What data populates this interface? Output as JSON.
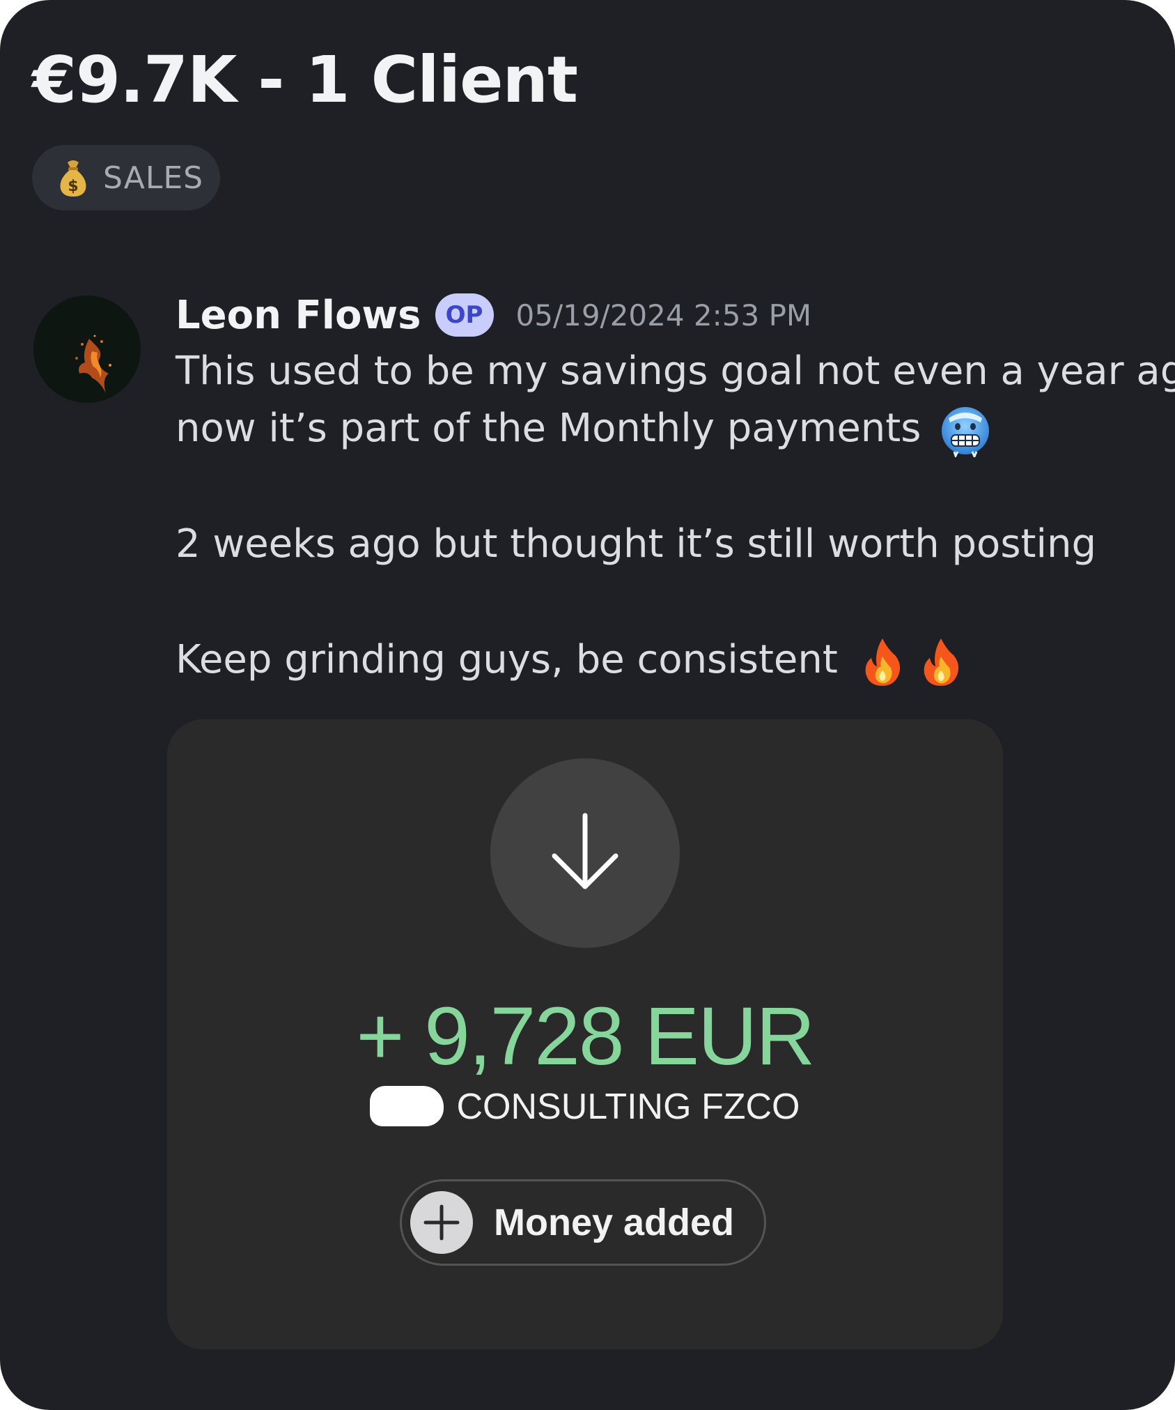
{
  "post": {
    "title": "€9.7K - 1 Client",
    "tag": {
      "icon": "money-bag-icon",
      "label": "SALES"
    }
  },
  "message": {
    "author": "Leon Flows",
    "badge": "OP",
    "timestamp": "05/19/2024 2:53 PM",
    "avatar_icon": "fire-figure-avatar",
    "lines": {
      "l1": "This used to be my savings goal not even a year ago,",
      "l2": "now it’s part of the Monthly payments",
      "l3": "2 weeks ago but thought it’s still worth posting",
      "l4": "Keep grinding guys, be consistent"
    },
    "emojis": [
      "cold-face-emoji",
      "fire-emoji",
      "fire-emoji"
    ]
  },
  "attachment": {
    "icon": "arrow-down-icon",
    "amount": "+ 9,728 EUR",
    "payer": "CONSULTING FZCO",
    "status_icon": "plus-icon",
    "status": "Money added"
  },
  "colors": {
    "background": "#1f2025",
    "amount": "#86d59b",
    "badge_bg": "#c9cdfb",
    "badge_text": "#3b46c8"
  }
}
